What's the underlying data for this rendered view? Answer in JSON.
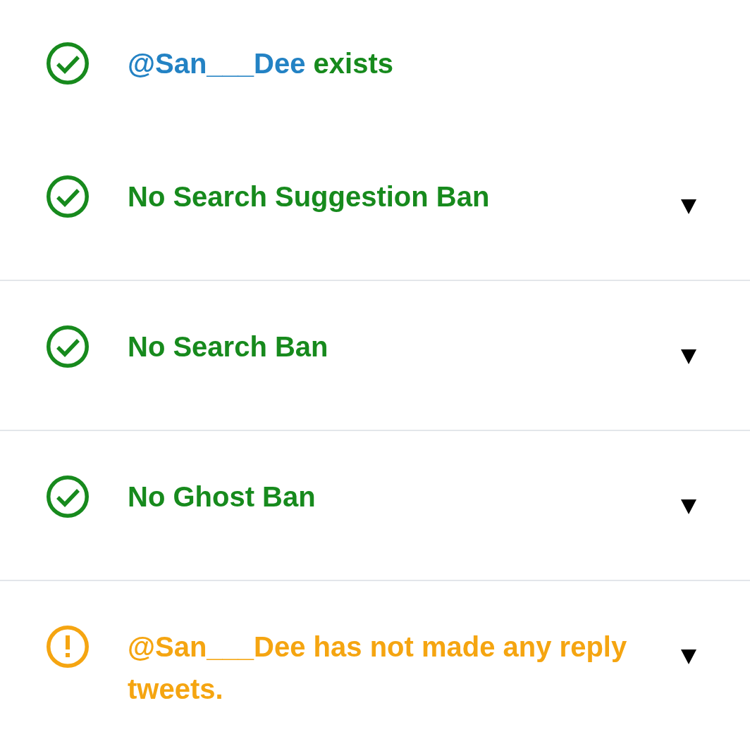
{
  "account_check": {
    "kind": "pass",
    "handle": "@San___Dee",
    "message": "exists"
  },
  "checks": [
    {
      "kind": "pass",
      "expanded": false,
      "message": "No Search Suggestion Ban"
    },
    {
      "kind": "pass",
      "expanded": false,
      "message": "No Search Ban"
    },
    {
      "kind": "pass",
      "expanded": false,
      "message": "No Ghost Ban"
    },
    {
      "kind": "warning",
      "expanded": false,
      "message": "@San___Dee has not made any reply tweets."
    }
  ]
}
